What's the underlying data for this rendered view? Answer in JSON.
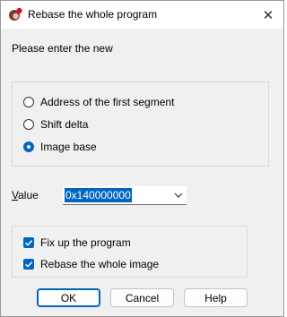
{
  "window": {
    "title": "Rebase the whole program",
    "close_glyph": "✕"
  },
  "prompt": "Please enter the new",
  "radio_group": {
    "options": [
      {
        "label": "Address of the first segment",
        "checked": false
      },
      {
        "label": "Shift delta",
        "checked": false
      },
      {
        "label": "Image base",
        "checked": true
      }
    ]
  },
  "value": {
    "label_accel": "V",
    "label_rest": "alue",
    "current": "0x140000000"
  },
  "options": {
    "items": [
      {
        "label": "Fix up the program",
        "checked": true
      },
      {
        "label": "Rebase the whole image",
        "checked": true
      }
    ]
  },
  "buttons": {
    "ok": "OK",
    "cancel": "Cancel",
    "help": "Help"
  },
  "colors": {
    "accent": "#0067c0"
  }
}
